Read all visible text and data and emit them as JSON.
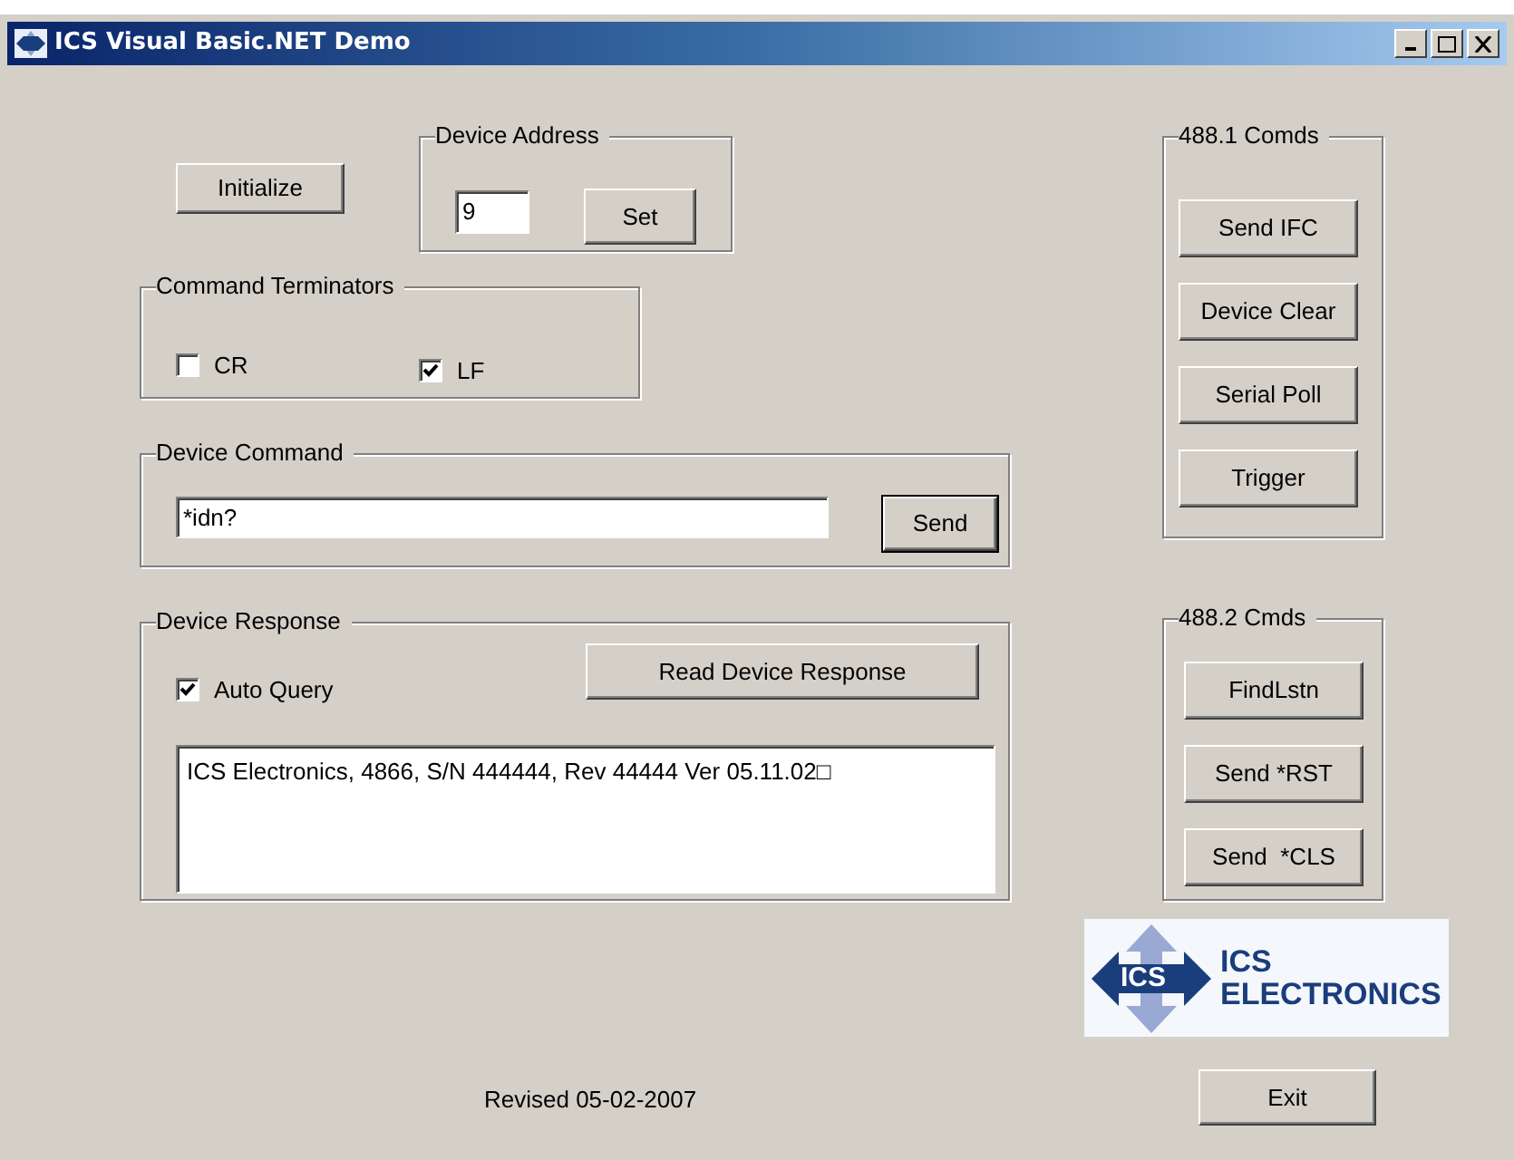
{
  "window": {
    "title": "ICS Visual Basic.NET Demo"
  },
  "initialize_button": "Initialize",
  "device_address": {
    "title": "Device Address",
    "value": "9",
    "button": "Set"
  },
  "command_terminators": {
    "title": "Command Terminators",
    "options": [
      {
        "label": "CR",
        "checked": false
      },
      {
        "label": "LF",
        "checked": true
      }
    ]
  },
  "device_command": {
    "title": "Device Command",
    "value": "*idn?",
    "button": "Send"
  },
  "device_response": {
    "title": "Device Response",
    "auto_query": {
      "label": "Auto Query",
      "checked": true
    },
    "button": "Read Device Response",
    "response": "ICS Electronics, 4866, S/N 444444, Rev 44444 Ver 05.11.02□"
  },
  "cmds_488_1": {
    "title": "488.1 Comds",
    "buttons": [
      "Send IFC",
      "Device Clear",
      "Serial Poll",
      "Trigger"
    ]
  },
  "cmds_488_2": {
    "title": "488.2 Cmds",
    "buttons": [
      "FindLstn",
      "Send *RST",
      "Send  *CLS"
    ]
  },
  "logo": {
    "badge": "ICS",
    "lines": [
      "ICS",
      "ELECTRONICS"
    ]
  },
  "revised": "Revised 05-02-2007",
  "exit_button": "Exit"
}
